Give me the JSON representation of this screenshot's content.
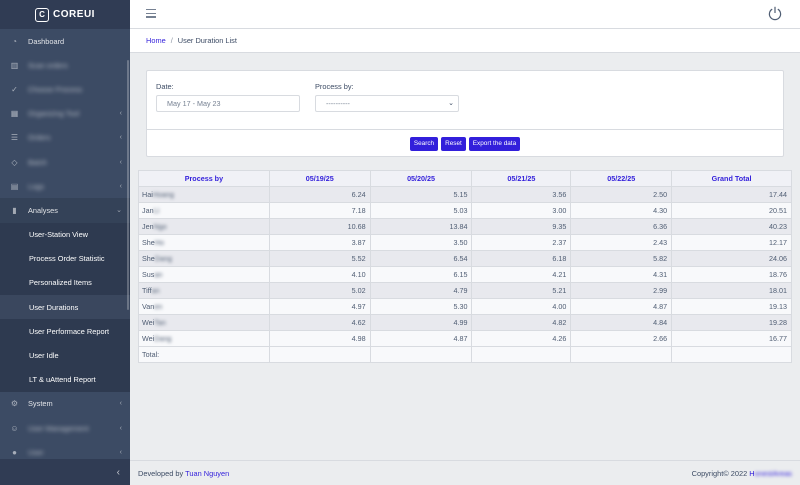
{
  "brand": {
    "logo": "C",
    "name": "COREUI"
  },
  "sidebar": {
    "items_top": [
      {
        "label": "Dashboard",
        "icon": "speedometer-icon",
        "blur": false,
        "chevron": false
      },
      {
        "label": "Scan orders",
        "icon": "barcode-icon",
        "blur": true,
        "chevron": false
      },
      {
        "label": "Choose Process",
        "icon": "check-icon",
        "blur": true,
        "chevron": false
      },
      {
        "label": "Organizing Tool",
        "icon": "grid-icon",
        "blur": true,
        "chevron": true
      },
      {
        "label": "Orders",
        "icon": "list-icon",
        "blur": true,
        "chevron": true
      },
      {
        "label": "Batch",
        "icon": "layers-icon",
        "blur": true,
        "chevron": true
      },
      {
        "label": "Logs",
        "icon": "file-icon",
        "blur": true,
        "chevron": true
      }
    ],
    "analyses": {
      "label": "Analyses",
      "icon": "chart-icon"
    },
    "sub_items": [
      {
        "label": "User-Station View",
        "active": false
      },
      {
        "label": "Process Order Statistic",
        "active": false
      },
      {
        "label": "Personalized Items",
        "active": false
      },
      {
        "label": "User Durations",
        "active": true
      },
      {
        "label": "User Performace Report",
        "active": false
      },
      {
        "label": "User Idle",
        "active": false
      },
      {
        "label": "LT & uAttend Report",
        "active": false
      }
    ],
    "items_bottom": [
      {
        "label": "System",
        "icon": "settings-icon",
        "blur": false,
        "chevron": true
      },
      {
        "label": "User Management",
        "icon": "people-icon",
        "blur": true,
        "chevron": true
      },
      {
        "label": "User",
        "icon": "user-icon",
        "blur": true,
        "chevron": true
      }
    ],
    "collapse_icon": "‹"
  },
  "breadcrumb": {
    "home": "Home",
    "separator": "/",
    "current": "User Duration List"
  },
  "filters": {
    "date_label": "Date:",
    "date_value": "May 17 - May 23",
    "process_label": "Process by:",
    "process_value": "----------"
  },
  "buttons": {
    "search": "Search",
    "reset": "Reset",
    "export": "Export the data"
  },
  "table": {
    "headers": [
      "Process by",
      "05/19/25",
      "05/20/25",
      "05/21/25",
      "05/22/25",
      "Grand Total"
    ],
    "rows": [
      {
        "name_visible": "Hai",
        "name_hidden": "Hoang",
        "values": [
          "6.24",
          "5.15",
          "3.56",
          "2.50",
          "17.44"
        ]
      },
      {
        "name_visible": "Jan",
        "name_hidden": "Li",
        "values": [
          "7.18",
          "5.03",
          "3.00",
          "4.30",
          "20.51"
        ]
      },
      {
        "name_visible": "Jen",
        "name_hidden": "Ngo",
        "values": [
          "10.68",
          "13.84",
          "9.35",
          "6.36",
          "40.23"
        ]
      },
      {
        "name_visible": "She",
        "name_hidden": "Ho",
        "values": [
          "3.87",
          "3.50",
          "2.37",
          "2.43",
          "12.17"
        ]
      },
      {
        "name_visible": "She",
        "name_hidden": "Dang",
        "values": [
          "5.52",
          "6.54",
          "6.18",
          "5.82",
          "24.06"
        ]
      },
      {
        "name_visible": "Sus",
        "name_hidden": "an",
        "values": [
          "4.10",
          "6.15",
          "4.21",
          "4.31",
          "18.76"
        ]
      },
      {
        "name_visible": "Tiff",
        "name_hidden": "an",
        "values": [
          "5.02",
          "4.79",
          "5.21",
          "2.99",
          "18.01"
        ]
      },
      {
        "name_visible": "Van",
        "name_hidden": "en",
        "values": [
          "4.97",
          "5.30",
          "4.00",
          "4.87",
          "19.13"
        ]
      },
      {
        "name_visible": "Wei",
        "name_hidden": "Tan",
        "values": [
          "4.62",
          "4.99",
          "4.82",
          "4.84",
          "19.28"
        ]
      },
      {
        "name_visible": "Wei",
        "name_hidden": "Dang",
        "values": [
          "4.98",
          "4.87",
          "4.26",
          "2.66",
          "16.77"
        ]
      }
    ],
    "total_label": "Total:"
  },
  "footer": {
    "developed_prefix": "Developed by",
    "developer": "Tuan Nguyen",
    "copyright_prefix": "Copyright© 2022",
    "company_visible": "H",
    "company_hidden": "onestAreas"
  },
  "colors": {
    "sidebar": "#3c4b64",
    "primary": "#321fdb",
    "background": "#ebedef"
  }
}
